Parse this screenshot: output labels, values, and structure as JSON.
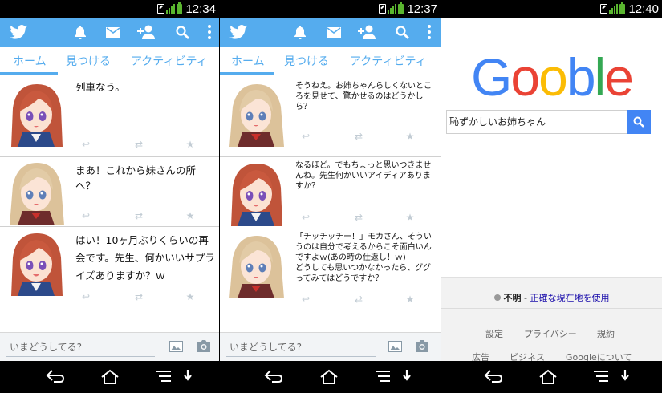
{
  "screens": [
    {
      "status_time": "12:34",
      "tabs": [
        "ホーム",
        "見つける",
        "アクティビティ"
      ],
      "tweets": [
        {
          "avatar": "red-haired-girl-avatar",
          "text": "列車なう。"
        },
        {
          "avatar": "blonde-girl-avatar",
          "text": "まあ！これから妹さんの所へ？"
        },
        {
          "avatar": "red-haired-girl-avatar",
          "text": "はい！10ヶ月ぶりくらいの再会です。先生、何かいいサプライズありますか？ｗ"
        }
      ],
      "compose_placeholder": "いまどうしてる?"
    },
    {
      "status_time": "12:37",
      "tabs": [
        "ホーム",
        "見つける",
        "アクティビティ"
      ],
      "tweets": [
        {
          "avatar": "blonde-girl-avatar",
          "text": "そうねえ。お姉ちゃんらしくないところを見せて、驚かせるのはどうかしら？"
        },
        {
          "avatar": "red-haired-girl-avatar",
          "text": "なるほど。でもちょっと思いつきませんね。先生何かいいアイディアありますか？"
        },
        {
          "avatar": "blonde-girl-avatar",
          "text": "「チッチッチー！」モカさん、そういうのは自分で考えるからこそ面白いんですよｗ(あの時の仕返し！ｗ)\nどうしても思いつかなかったら、ググってみてはどうですか？"
        }
      ],
      "compose_placeholder": "いまどうしてる?"
    }
  ],
  "google": {
    "status_time": "12:40",
    "logo_letters": [
      {
        "ch": "G",
        "color": "#4285f4"
      },
      {
        "ch": "o",
        "color": "#ea4335"
      },
      {
        "ch": "o",
        "color": "#fbbc05"
      },
      {
        "ch": "b",
        "color": "#4285f4"
      },
      {
        "ch": "l",
        "color": "#34a853"
      },
      {
        "ch": "e",
        "color": "#ea4335"
      }
    ],
    "search_value": "恥ずかしいお姉ちゃん",
    "location_unknown": "不明",
    "location_sep": " - ",
    "location_link": "正確な現在地を使用",
    "footer_links_1": [
      "設定",
      "プライバシー",
      "規約"
    ],
    "footer_links_2": [
      "広告",
      "ビジネス",
      "Googleについて"
    ]
  },
  "colors": {
    "twitter_blue": "#55acee",
    "google_blue": "#4285f4",
    "status_green": "#5ab62f"
  }
}
